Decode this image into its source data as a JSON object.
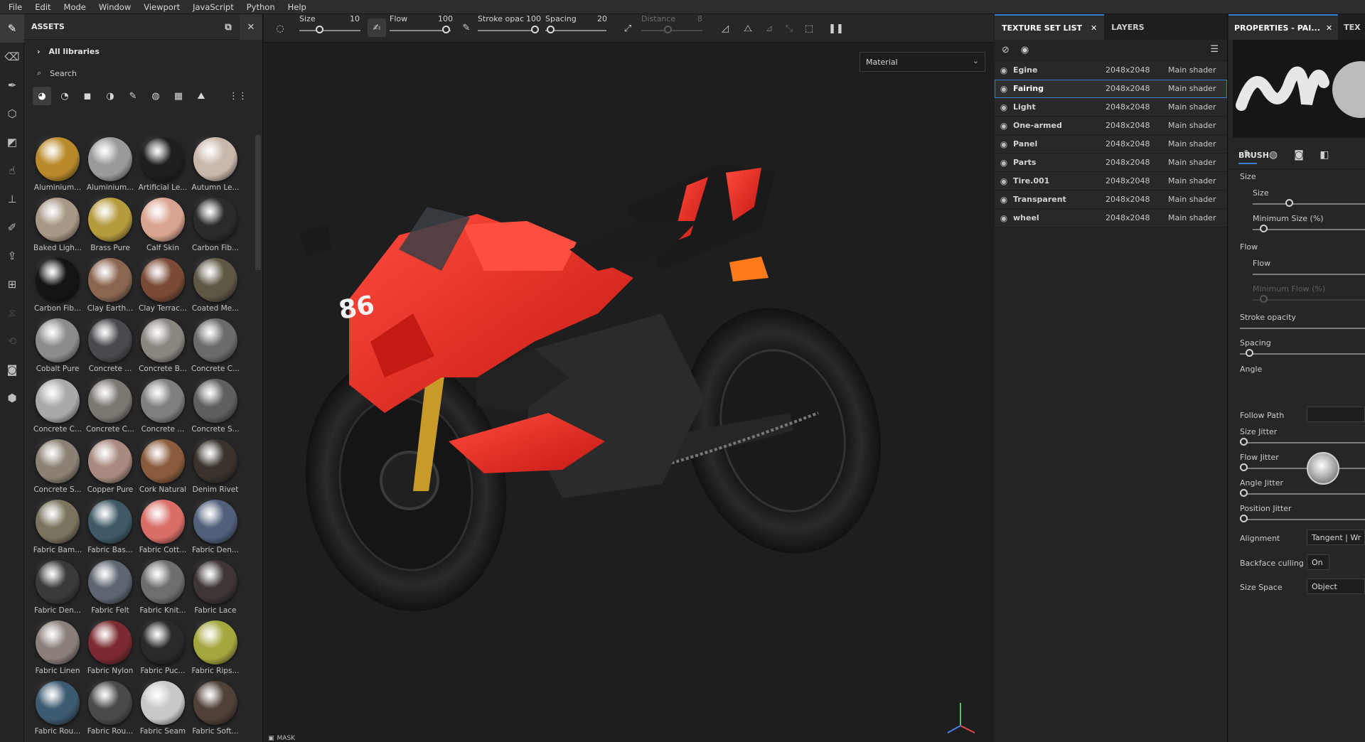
{
  "menu": [
    "File",
    "Edit",
    "Mode",
    "Window",
    "Viewport",
    "JavaScript",
    "Python",
    "Help"
  ],
  "tools": [
    "paint-brush-icon",
    "eraser-icon",
    "projection-icon",
    "geometry-mask-icon",
    "polygon-fill-icon",
    "smudge-icon",
    "clone-stamp-icon",
    "color-picker-icon",
    "bake-icon",
    "export-icon",
    "shelf-icon",
    "history-icon",
    "display-icon",
    "log-icon"
  ],
  "assets": {
    "title": "ASSETS",
    "libraries": "All libraries",
    "search_placeholder": "Search",
    "items": [
      {
        "label": "Aluminium...",
        "color": "#b98a2a"
      },
      {
        "label": "Aluminium...",
        "color": "#9a9a9a"
      },
      {
        "label": "Artificial Le...",
        "color": "#1f1f1f"
      },
      {
        "label": "Autumn Le...",
        "color": "#c9b7aa"
      },
      {
        "label": "Baked Ligh...",
        "color": "#a79784"
      },
      {
        "label": "Brass Pure",
        "color": "#b59a3e"
      },
      {
        "label": "Calf Skin",
        "color": "#d9a48f"
      },
      {
        "label": "Carbon Fib...",
        "color": "#2b2b2b"
      },
      {
        "label": "Carbon Fib...",
        "color": "#141414"
      },
      {
        "label": "Clay Earth...",
        "color": "#8a6650"
      },
      {
        "label": "Clay Terrac...",
        "color": "#7a4a36"
      },
      {
        "label": "Coated Me...",
        "color": "#5e5744"
      },
      {
        "label": "Cobalt Pure",
        "color": "#8c8c8c"
      },
      {
        "label": "Concrete ...",
        "color": "#4a4a4e"
      },
      {
        "label": "Concrete B...",
        "color": "#8b8680"
      },
      {
        "label": "Concrete C...",
        "color": "#6b6b6b"
      },
      {
        "label": "Concrete C...",
        "color": "#a9a9a9"
      },
      {
        "label": "Concrete C...",
        "color": "#7b7771"
      },
      {
        "label": "Concrete ...",
        "color": "#7f7f7d"
      },
      {
        "label": "Concrete S...",
        "color": "#5f5f5f"
      },
      {
        "label": "Concrete S...",
        "color": "#8c8274"
      },
      {
        "label": "Copper Pure",
        "color": "#a88a80"
      },
      {
        "label": "Cork Natural",
        "color": "#8a5b3c"
      },
      {
        "label": "Denim Rivet",
        "color": "#3a332c"
      },
      {
        "label": "Fabric Bam...",
        "color": "#7a735e"
      },
      {
        "label": "Fabric Bas...",
        "color": "#3f5a66"
      },
      {
        "label": "Fabric Cott...",
        "color": "#d96e66"
      },
      {
        "label": "Fabric Den...",
        "color": "#50607a"
      },
      {
        "label": "Fabric Den...",
        "color": "#3a3a3a"
      },
      {
        "label": "Fabric Felt",
        "color": "#5d6570"
      },
      {
        "label": "Fabric Knit...",
        "color": "#6e6e6e"
      },
      {
        "label": "Fabric Lace",
        "color": "#3e3535"
      },
      {
        "label": "Fabric Linen",
        "color": "#8a7f79"
      },
      {
        "label": "Fabric Nylon",
        "color": "#7a2a30"
      },
      {
        "label": "Fabric Puc...",
        "color": "#2a2a2a"
      },
      {
        "label": "Fabric Rips...",
        "color": "#a4a63e"
      },
      {
        "label": "Fabric Rou...",
        "color": "#3c5a70"
      },
      {
        "label": "Fabric Rou...",
        "color": "#4a4a4a"
      },
      {
        "label": "Fabric Seam",
        "color": "#c8c8c8"
      },
      {
        "label": "Fabric Soft...",
        "color": "#4f4038"
      }
    ]
  },
  "toolbar": {
    "size_label": "Size",
    "size_value": "10",
    "flow_label": "Flow",
    "flow_value": "100",
    "stroke_label": "Stroke opac",
    "stroke_value": "100",
    "spacing_label": "Spacing",
    "spacing_value": "20",
    "distance_label": "Distance",
    "distance_value": "8"
  },
  "viewport": {
    "material_mode": "Material",
    "mask_label": "MASK",
    "number_decal": "86"
  },
  "texture_set": {
    "tab_active": "TEXTURE SET LIST",
    "tab_layers": "LAYERS",
    "rows": [
      {
        "name": "Egine",
        "res": "2048x2048",
        "shader": "Main shader"
      },
      {
        "name": "Fairing",
        "res": "2048x2048",
        "shader": "Main shader"
      },
      {
        "name": "Light",
        "res": "2048x2048",
        "shader": "Main shader"
      },
      {
        "name": "One-armed",
        "res": "2048x2048",
        "shader": "Main shader"
      },
      {
        "name": "Panel",
        "res": "2048x2048",
        "shader": "Main shader"
      },
      {
        "name": "Parts",
        "res": "2048x2048",
        "shader": "Main shader"
      },
      {
        "name": "Tire.001",
        "res": "2048x2048",
        "shader": "Main shader"
      },
      {
        "name": "Transparent",
        "res": "2048x2048",
        "shader": "Main shader"
      },
      {
        "name": "wheel",
        "res": "2048x2048",
        "shader": "Main shader"
      }
    ],
    "selected": "Fairing"
  },
  "properties": {
    "tab_active": "PROPERTIES - PAI...",
    "tab_next": "TEX",
    "section": "BRUSH",
    "size_group": "Size",
    "size": "Size",
    "min_size": "Minimum Size (%)",
    "flow_group": "Flow",
    "flow": "Flow",
    "min_flow": "Minimum Flow (%)",
    "stroke_opacity": "Stroke opacity",
    "spacing": "Spacing",
    "angle": "Angle",
    "follow_path": "Follow Path",
    "size_jitter": "Size Jitter",
    "flow_jitter": "Flow Jitter",
    "angle_jitter": "Angle Jitter",
    "position_jitter": "Position Jitter",
    "alignment": "Alignment",
    "alignment_value": "Tangent | Wr",
    "backface": "Backface culling",
    "backface_value": "On",
    "size_space": "Size Space",
    "size_space_value": "Object"
  },
  "colors": {
    "accent": "#3b7fd1",
    "bike_red": "#e8261e",
    "bg": "#1e1e1e"
  }
}
